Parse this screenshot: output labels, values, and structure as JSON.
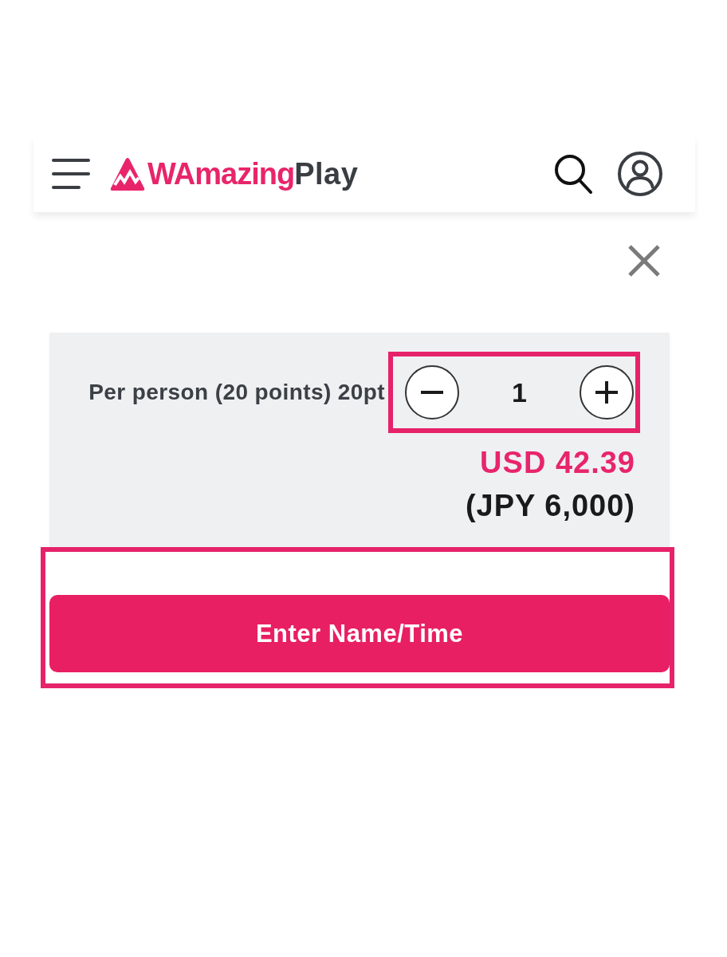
{
  "header": {
    "logo": {
      "brand": "WAmazing",
      "product": "Play"
    }
  },
  "ticket": {
    "label": "Per person (20 points) 20pt",
    "quantity": "1",
    "highlighted": true,
    "price": "USD 42.39",
    "price_local": "(JPY 6,000)"
  },
  "action": {
    "label": "Enter Name/Time",
    "highlighted": true
  }
}
